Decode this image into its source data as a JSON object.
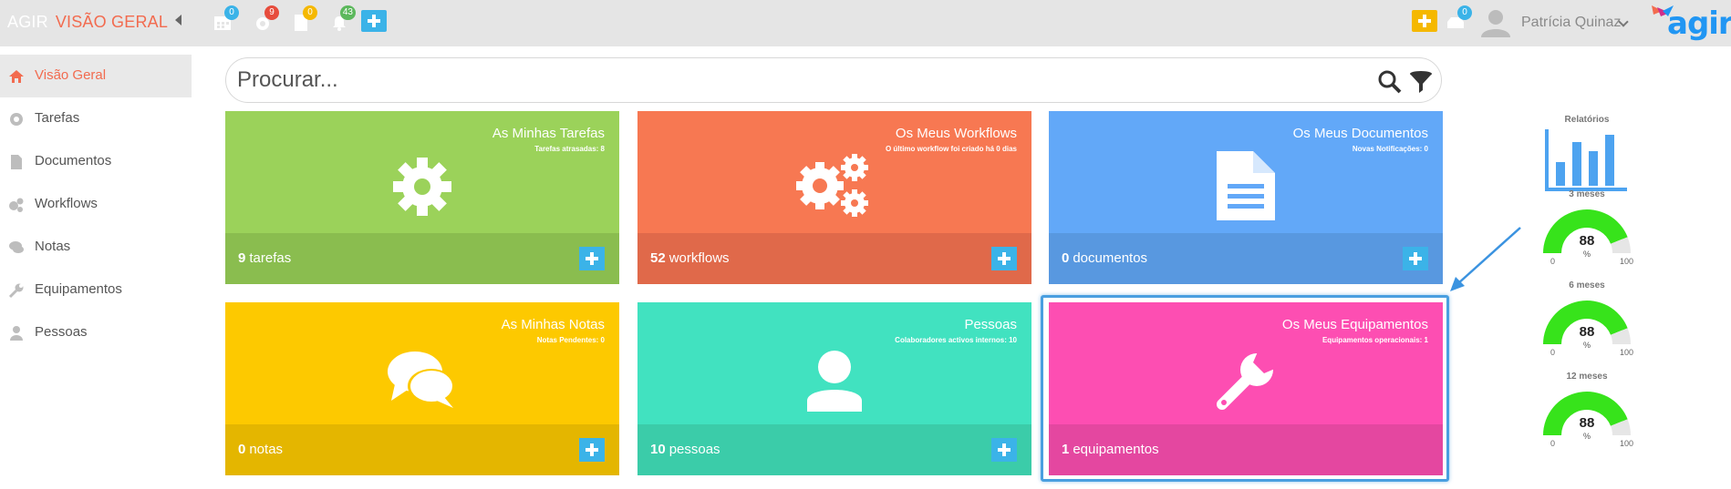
{
  "header": {
    "brand": "AGIR",
    "section": "VISÃO GERAL",
    "badges": {
      "calendar": "0",
      "tasks": "9",
      "documents": "0",
      "notifications": "43",
      "messages": "0"
    },
    "user_name": "Patrícia Quinaz",
    "logo_text": "agir",
    "colors": {
      "blue_badge": "#3bb3e8",
      "red_badge": "#e74c3c",
      "yellow_badge": "#f5b800",
      "green_badge": "#5cb85c"
    }
  },
  "sidebar": {
    "items": [
      {
        "label": "Visão Geral",
        "icon": "home-icon",
        "active": true
      },
      {
        "label": "Tarefas",
        "icon": "gear-icon"
      },
      {
        "label": "Documentos",
        "icon": "document-icon"
      },
      {
        "label": "Workflows",
        "icon": "gears-icon"
      },
      {
        "label": "Notas",
        "icon": "chat-icon"
      },
      {
        "label": "Equipamentos",
        "icon": "wrench-icon"
      },
      {
        "label": "Pessoas",
        "icon": "person-icon"
      }
    ]
  },
  "search": {
    "placeholder": "Procurar..."
  },
  "tiles": [
    {
      "title": "As Minhas Tarefas",
      "subtitle": "Tarefas atrasadas: 8",
      "count": "9",
      "unit": "tarefas",
      "icon": "gear-icon",
      "color_top": "#9bd25a",
      "color_bottom": "#8abd4f"
    },
    {
      "title": "Os Meus Workflows",
      "subtitle": "O último workflow foi criado há 0 dias",
      "count": "52",
      "unit": "workflows",
      "icon": "gears-icon",
      "color_top": "#f77852",
      "color_bottom": "#e0694a"
    },
    {
      "title": "Os Meus Documentos",
      "subtitle": "Novas Notificações: 0",
      "count": "0",
      "unit": "documentos",
      "icon": "document-icon",
      "color_top": "#62a8f8",
      "color_bottom": "#5898e0"
    },
    {
      "title": "As Minhas Notas",
      "subtitle": "Notas Pendentes: 0",
      "count": "0",
      "unit": "notas",
      "icon": "chat-icon",
      "color_top": "#fdc900",
      "color_bottom": "#e4b600"
    },
    {
      "title": "Pessoas",
      "subtitle": "Colaboradores activos internos: 10",
      "count": "10",
      "unit": "pessoas",
      "icon": "person-icon",
      "color_top": "#41e2c0",
      "color_bottom": "#3bcca9"
    },
    {
      "title": "Os Meus Equipamentos",
      "subtitle": "Equipamentos operacionais: 1",
      "count": "1",
      "unit": "equipamentos",
      "icon": "wrench-icon",
      "color_top": "#fd4eb2",
      "color_bottom": "#e447a0"
    }
  ],
  "reports": {
    "title": "Relatórios",
    "gauges": [
      {
        "label": "3 meses",
        "value": "88",
        "unit": "%",
        "min": "0",
        "max": "100",
        "fraction": 0.88
      },
      {
        "label": "6 meses",
        "value": "88",
        "unit": "%",
        "min": "0",
        "max": "100",
        "fraction": 0.88
      },
      {
        "label": "12 meses",
        "value": "88",
        "unit": "%",
        "min": "0",
        "max": "100",
        "fraction": 0.88
      }
    ],
    "gauge_color": "#37e31b"
  }
}
